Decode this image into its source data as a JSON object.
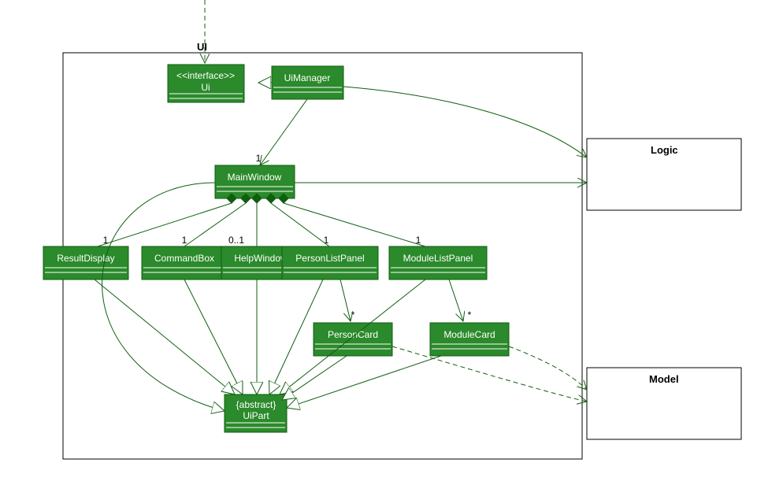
{
  "ui_package": {
    "label": "UI"
  },
  "logic_package": {
    "label": "Logic"
  },
  "model_package": {
    "label": "Model"
  },
  "classes": {
    "ui": {
      "stereotype": "<<interface>>",
      "name": "Ui"
    },
    "ui_manager": {
      "name": "UiManager"
    },
    "main_window": {
      "name": "MainWindow"
    },
    "result_display": {
      "name": "ResultDisplay"
    },
    "command_box": {
      "name": "CommandBox"
    },
    "help_window": {
      "name": "HelpWindow"
    },
    "person_list_panel": {
      "name": "PersonListPanel"
    },
    "module_list_panel": {
      "name": "ModuleListPanel"
    },
    "person_card": {
      "name": "PersonCard"
    },
    "module_card": {
      "name": "ModuleCard"
    },
    "ui_part": {
      "stereotype": "{abstract}",
      "name": "UiPart"
    }
  },
  "multiplicities": {
    "main_window": "1",
    "result_display": "1",
    "command_box": "1",
    "help_window": "0..1",
    "person_list_panel": "1",
    "module_list_panel": "1",
    "person_card": "*",
    "module_card": "*"
  },
  "chart_data": {
    "type": "uml-class-diagram",
    "packages": [
      {
        "name": "UI",
        "contains": [
          "Ui",
          "UiManager",
          "MainWindow",
          "ResultDisplay",
          "CommandBox",
          "HelpWindow",
          "PersonListPanel",
          "ModuleListPanel",
          "PersonCard",
          "ModuleCard",
          "UiPart"
        ]
      },
      {
        "name": "Logic",
        "contains": []
      },
      {
        "name": "Model",
        "contains": []
      }
    ],
    "classes": [
      {
        "name": "Ui",
        "stereotype": "<<interface>>"
      },
      {
        "name": "UiManager"
      },
      {
        "name": "MainWindow"
      },
      {
        "name": "ResultDisplay"
      },
      {
        "name": "CommandBox"
      },
      {
        "name": "HelpWindow"
      },
      {
        "name": "PersonListPanel"
      },
      {
        "name": "ModuleListPanel"
      },
      {
        "name": "PersonCard"
      },
      {
        "name": "ModuleCard"
      },
      {
        "name": "UiPart",
        "stereotype": "{abstract}"
      }
    ],
    "relationships": [
      {
        "from": "(external)",
        "to": "Ui",
        "type": "dependency",
        "style": "dashed"
      },
      {
        "from": "UiManager",
        "to": "Ui",
        "type": "realization"
      },
      {
        "from": "UiManager",
        "to": "MainWindow",
        "type": "association-directed",
        "multiplicity_to": "1"
      },
      {
        "from": "UiManager",
        "to": "Logic",
        "type": "association-directed"
      },
      {
        "from": "MainWindow",
        "to": "Logic",
        "type": "association-directed"
      },
      {
        "from": "MainWindow",
        "to": "ResultDisplay",
        "type": "composition",
        "multiplicity_to": "1"
      },
      {
        "from": "MainWindow",
        "to": "CommandBox",
        "type": "composition",
        "multiplicity_to": "1"
      },
      {
        "from": "MainWindow",
        "to": "HelpWindow",
        "type": "composition",
        "multiplicity_to": "0..1"
      },
      {
        "from": "MainWindow",
        "to": "PersonListPanel",
        "type": "composition",
        "multiplicity_to": "1"
      },
      {
        "from": "MainWindow",
        "to": "ModuleListPanel",
        "type": "composition",
        "multiplicity_to": "1"
      },
      {
        "from": "PersonListPanel",
        "to": "PersonCard",
        "type": "association-directed",
        "multiplicity_to": "*"
      },
      {
        "from": "ModuleListPanel",
        "to": "ModuleCard",
        "type": "association-directed",
        "multiplicity_to": "*"
      },
      {
        "from": "MainWindow",
        "to": "UiPart",
        "type": "generalization"
      },
      {
        "from": "ResultDisplay",
        "to": "UiPart",
        "type": "generalization"
      },
      {
        "from": "CommandBox",
        "to": "UiPart",
        "type": "generalization"
      },
      {
        "from": "HelpWindow",
        "to": "UiPart",
        "type": "generalization"
      },
      {
        "from": "PersonListPanel",
        "to": "UiPart",
        "type": "generalization"
      },
      {
        "from": "ModuleListPanel",
        "to": "UiPart",
        "type": "generalization"
      },
      {
        "from": "PersonCard",
        "to": "UiPart",
        "type": "generalization"
      },
      {
        "from": "ModuleCard",
        "to": "UiPart",
        "type": "generalization"
      },
      {
        "from": "PersonCard",
        "to": "Model",
        "type": "dependency",
        "style": "dashed"
      },
      {
        "from": "ModuleCard",
        "to": "Model",
        "type": "dependency",
        "style": "dashed"
      }
    ]
  }
}
